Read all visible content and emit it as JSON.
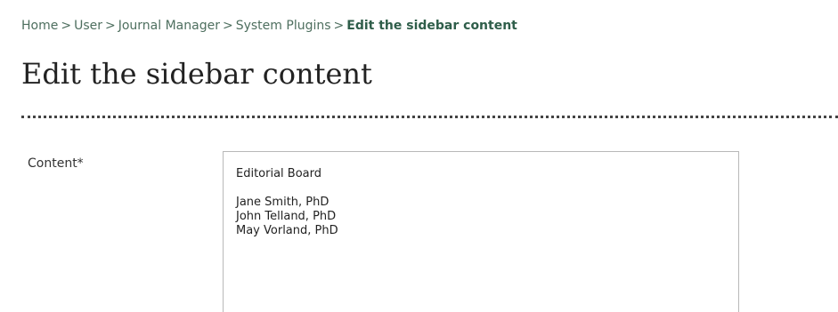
{
  "breadcrumb": {
    "items": [
      "Home",
      "User",
      "Journal Manager",
      "System Plugins"
    ],
    "separator": ">",
    "current": "Edit the sidebar content"
  },
  "page": {
    "title": "Edit the sidebar content"
  },
  "form": {
    "content_label": "Content*",
    "content_value": {
      "heading": "Editorial Board",
      "lines": [
        "Jane Smith, PhD",
        "John Telland, PhD",
        "May Vorland, PhD"
      ]
    }
  }
}
